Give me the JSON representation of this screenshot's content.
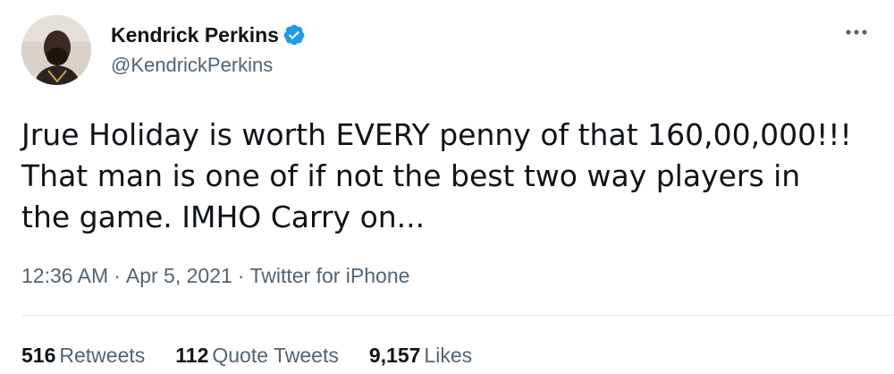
{
  "author": {
    "name": "Kendrick Perkins",
    "handle": "@KendrickPerkins",
    "verified": true,
    "verified_icon": "verified-badge-icon",
    "avatar_icon": "avatar"
  },
  "menu": {
    "icon": "more-options-icon"
  },
  "tweet": {
    "lines": [
      "Jrue Holiday is worth EVERY penny of that 160,00,000!!!",
      "That man is one of if not the best two way players in",
      "the game. IMHO Carry on..."
    ]
  },
  "meta": {
    "time": "12:36 AM",
    "separator": "·",
    "date": "Apr 5, 2021",
    "source": "Twitter for iPhone"
  },
  "stats": {
    "retweets_count": "516",
    "retweets_label": "Retweets",
    "quotes_count": "112",
    "quotes_label": "Quote Tweets",
    "likes_count": "9,157",
    "likes_label": "Likes"
  },
  "colors": {
    "verified_blue": "#1d9bf0",
    "secondary_text": "#536471",
    "primary_text": "#0f1419",
    "divider": "#e6ecf0"
  }
}
